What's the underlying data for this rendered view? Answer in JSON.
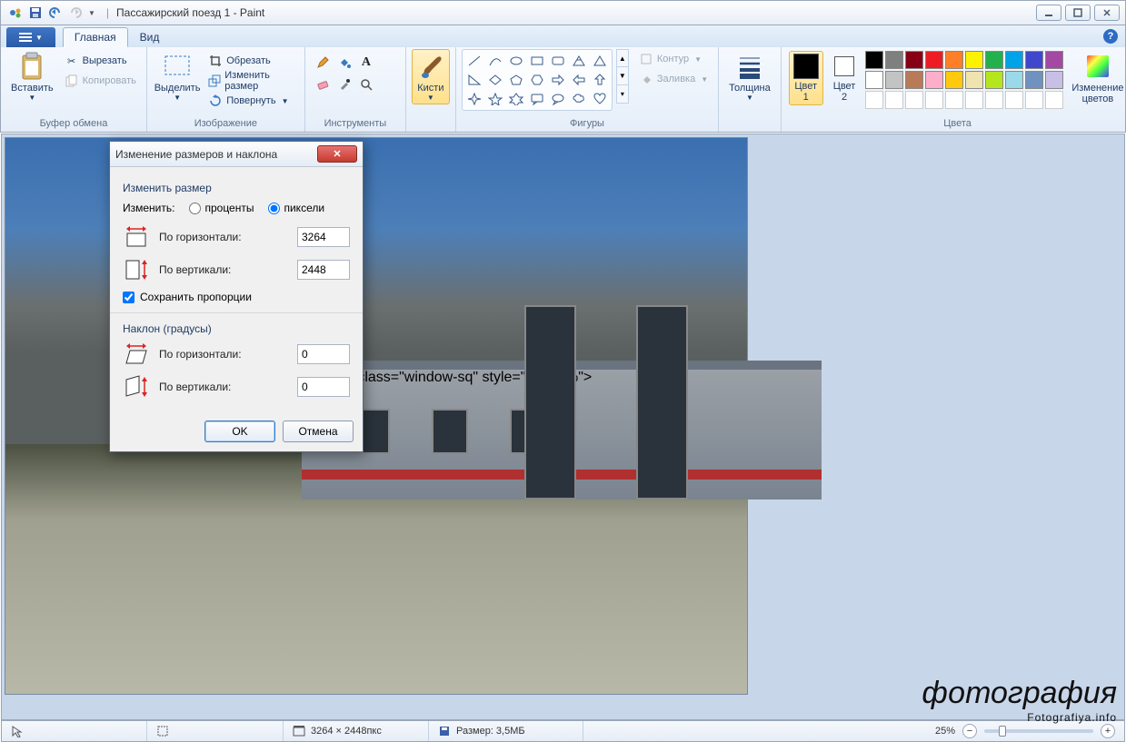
{
  "window": {
    "title": "Пассажирский поезд 1 - Paint"
  },
  "tabs": {
    "file": "",
    "home": "Главная",
    "view": "Вид"
  },
  "ribbon": {
    "clipboard": {
      "paste": "Вставить",
      "cut": "Вырезать",
      "copy": "Копировать",
      "label": "Буфер обмена"
    },
    "image": {
      "select": "Выделить",
      "crop": "Обрезать",
      "resize": "Изменить размер",
      "rotate": "Повернуть",
      "label": "Изображение"
    },
    "tools": {
      "label": "Инструменты"
    },
    "brushes": {
      "label": "Кисти"
    },
    "shapes": {
      "outline": "Контур",
      "fill": "Заливка",
      "label": "Фигуры"
    },
    "size": {
      "label": "Толщина"
    },
    "colors": {
      "color1": "Цвет 1",
      "color2": "Цвет 2",
      "edit": "Изменение цветов",
      "label": "Цвета",
      "primary": "#000000",
      "secondary": "#ffffff",
      "palette_row1": [
        "#000000",
        "#7f7f7f",
        "#880015",
        "#ed1c24",
        "#ff7f27",
        "#fff200",
        "#22b14c",
        "#00a2e8",
        "#3f48cc",
        "#a349a4"
      ],
      "palette_row2": [
        "#ffffff",
        "#c3c3c3",
        "#b97a57",
        "#ffaec9",
        "#ffc90e",
        "#efe4b0",
        "#b5e61d",
        "#99d9ea",
        "#7092be",
        "#c8bfe7"
      ],
      "palette_row3": [
        "",
        "",
        "",
        "",
        "",
        "",
        "",
        "",
        "",
        ""
      ]
    }
  },
  "dialog": {
    "title": "Изменение размеров и наклона",
    "resize_section": "Изменить размер",
    "by_label": "Изменить:",
    "percent": "проценты",
    "pixels": "пиксели",
    "horizontal": "По горизонтали:",
    "vertical": "По вертикали:",
    "h_value": "3264",
    "v_value": "2448",
    "aspect": "Сохранить пропорции",
    "skew_section": "Наклон (градусы)",
    "skew_h": "0",
    "skew_v": "0",
    "ok": "OK",
    "cancel": "Отмена"
  },
  "statusbar": {
    "dimensions": "3264 × 2448пкс",
    "filesize": "Размер: 3,5МБ",
    "zoom": "25%"
  },
  "watermark": {
    "main": "фотография",
    "sub": "Fotografiya.info"
  }
}
